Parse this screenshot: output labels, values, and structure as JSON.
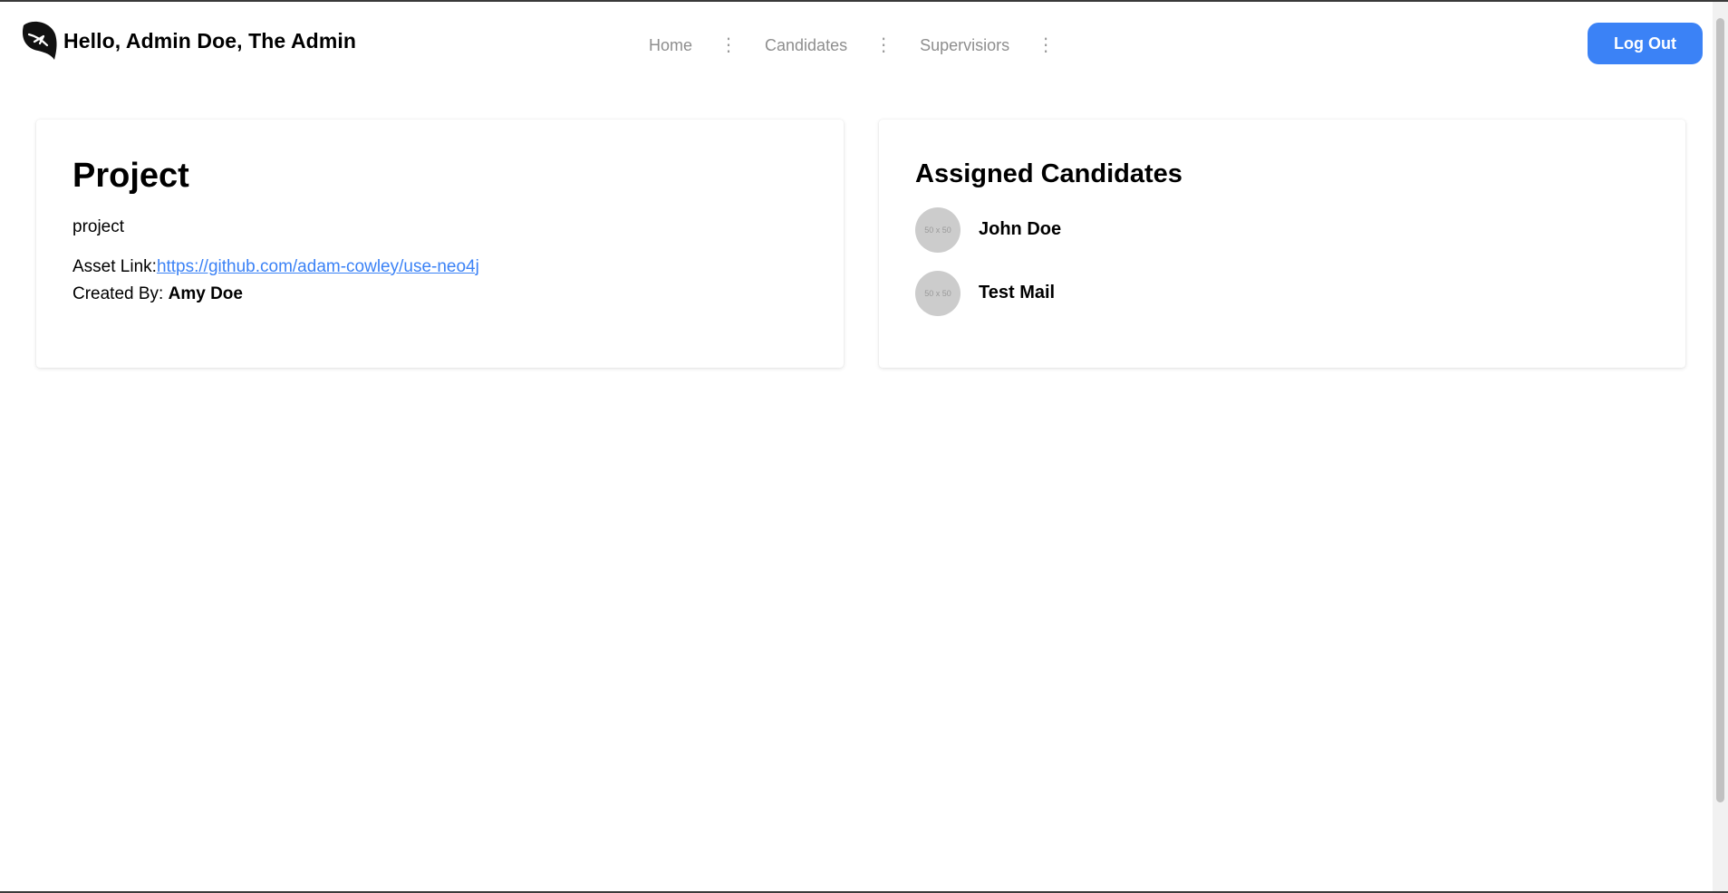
{
  "header": {
    "greeting": "Hello, Admin Doe, The Admin",
    "logo_icon": "bird-leaf-logo-icon",
    "nav": [
      {
        "label": "Home",
        "menu_icon": "vertical-dots-icon"
      },
      {
        "label": "Candidates",
        "menu_icon": "vertical-dots-icon"
      },
      {
        "label": "Supervisiors",
        "menu_icon": "vertical-dots-icon"
      }
    ],
    "logout_label": "Log Out",
    "accent_color": "#3b82f6"
  },
  "project": {
    "title": "Project",
    "description": "project",
    "asset_link_label": "Asset Link:",
    "asset_link_url": "https://github.com/adam-cowley/use-neo4j",
    "created_by_label": "Created By:",
    "created_by_name": "Amy Doe"
  },
  "assigned": {
    "title": "Assigned Candidates",
    "candidates": [
      {
        "avatar_text": "50 x 50",
        "name": "John Doe"
      },
      {
        "avatar_text": "50 x 50",
        "name": "Test Mail"
      }
    ]
  }
}
